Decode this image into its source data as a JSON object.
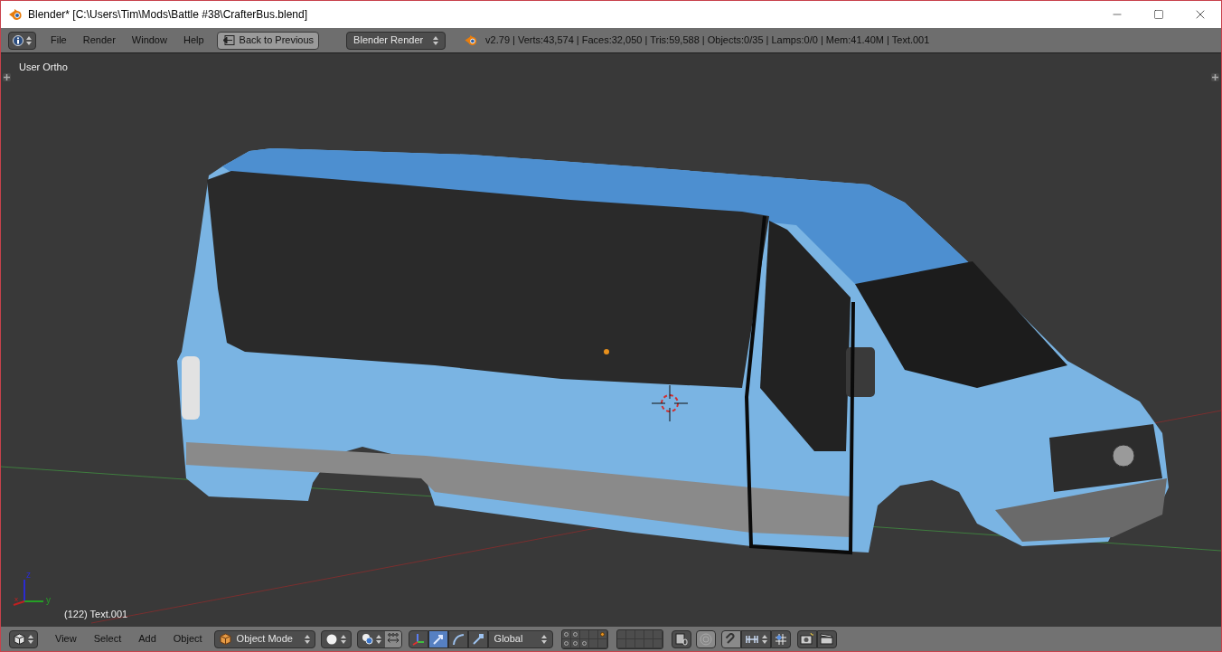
{
  "window": {
    "title": "Blender* [C:\\Users\\Tim\\Mods\\Battle #38\\CrafterBus.blend]"
  },
  "info_header": {
    "menus": [
      "File",
      "Render",
      "Window",
      "Help"
    ],
    "back_button": "Back to Previous",
    "render_engine": "Blender Render",
    "stats": "v2.79 | Verts:43,574 | Faces:32,050 | Tris:59,588 | Objects:0/35 | Lamps:0/0 | Mem:41.40M | Text.001"
  },
  "viewport": {
    "view_label": "User Ortho",
    "axis_labels": [
      "z",
      "x",
      "y"
    ],
    "object_info": "(122) Text.001"
  },
  "view3d_header": {
    "menus": [
      "View",
      "Select",
      "Add",
      "Object"
    ],
    "mode": "Object Mode",
    "manipulator_tools": [
      {
        "kind": "translate",
        "selected": true
      },
      {
        "kind": "rotate",
        "selected": false
      },
      {
        "kind": "scale",
        "selected": false
      }
    ],
    "orientation": "Global",
    "layer_blocks": [
      {
        "cells": [
          {
            "objects": true,
            "active_object": false
          },
          {
            "objects": true,
            "active_object": false
          },
          {
            "objects": false,
            "active_object": false
          },
          {
            "objects": false,
            "active_object": false
          },
          {
            "objects": false,
            "active_object": true
          },
          {
            "objects": true,
            "active_object": false
          },
          {
            "objects": true,
            "active_object": false
          },
          {
            "objects": true,
            "active_object": false
          },
          {
            "objects": false,
            "active_object": false
          },
          {
            "objects": false,
            "active_object": false
          }
        ]
      },
      {
        "cells": [
          {
            "objects": false,
            "active_object": false
          },
          {
            "objects": false,
            "active_object": false
          },
          {
            "objects": false,
            "active_object": false
          },
          {
            "objects": false,
            "active_object": false
          },
          {
            "objects": false,
            "active_object": false
          },
          {
            "objects": false,
            "active_object": false
          },
          {
            "objects": false,
            "active_object": false
          },
          {
            "objects": false,
            "active_object": false
          },
          {
            "objects": false,
            "active_object": false
          },
          {
            "objects": false,
            "active_object": false
          }
        ]
      }
    ]
  }
}
